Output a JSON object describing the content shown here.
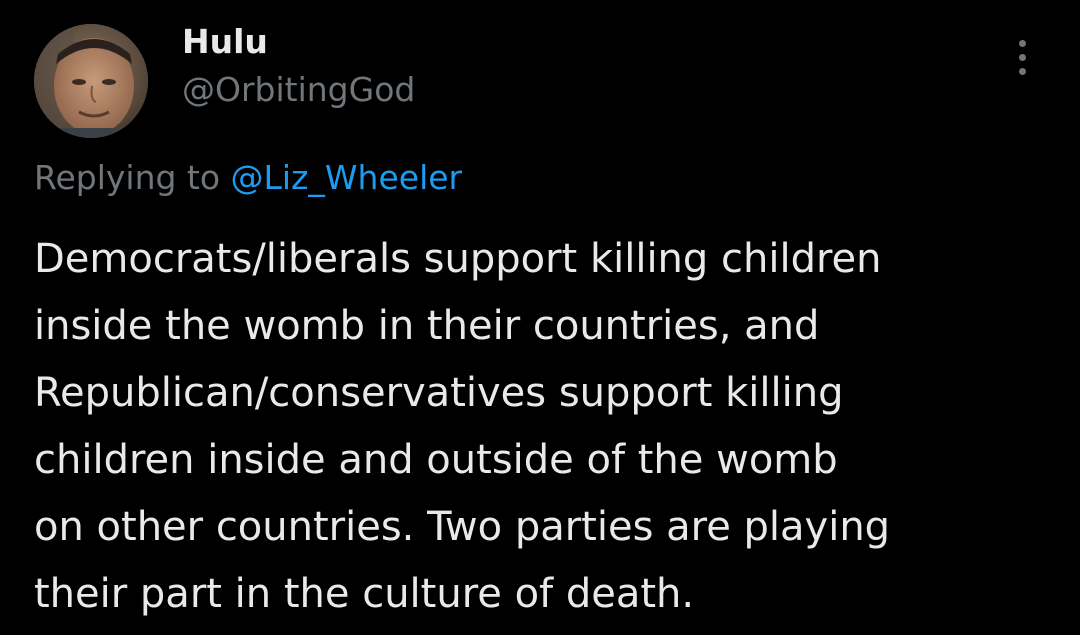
{
  "author": {
    "display_name": "Hulu",
    "handle": "@OrbitingGod",
    "avatar_icon": "profile-photo-avatar"
  },
  "menu": {
    "icon": "more-vertical-icon"
  },
  "reply": {
    "prefix": "Replying to",
    "target": "@Liz_Wheeler"
  },
  "tweet": {
    "lines": [
      "Democrats/liberals support killing children",
      "inside the womb in their countries, and",
      "Republican/conservatives support killing",
      "children inside and outside of the womb",
      "on other countries. Two parties are playing",
      "their part in the culture of death."
    ]
  },
  "colors": {
    "background": "#000000",
    "primary_text": "#e7e9ea",
    "secondary_text": "#71767b",
    "link": "#1d9bf0"
  }
}
